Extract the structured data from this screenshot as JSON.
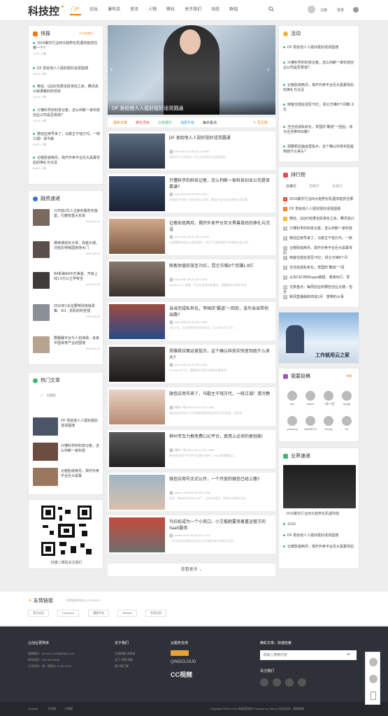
{
  "header": {
    "logo": "科技控",
    "nav": [
      "门户",
      "论坛",
      "瀑布流",
      "资讯",
      "人物",
      "孵化",
      "关于我们",
      "动态",
      "群组"
    ],
    "register": "注册",
    "login": "登录"
  },
  "kuaibao": {
    "title": "快报",
    "badge": "24小时排行",
    "items": [
      {
        "text": "2016餐饮行业四大趋势化机遇你能抓住哪一个?",
        "date": "17/04",
        "author": "小编"
      },
      {
        "text": "DF 发给他人人挺好挺好适货圆通",
        "date": "16:00",
        "author": "人物"
      },
      {
        "text": "微信、QQ红包遭全民将信之余，腾讯高兴就遭餐科的现状",
        "date": "16:00",
        "author": "人物"
      },
      {
        "text": "只懂科学的科技记者，怎么判断一家科技创业公司是否靠谱?",
        "date": "16:00",
        "author": "人物"
      },
      {
        "text": "微信应用号来了，马歇主干钱万代，一统江湖！请今静",
        "date": "09/02",
        "author": "人物"
      },
      {
        "text": "记者卧底两月，揭开外卖平台巨大黑幕背后的挣扎与沉没",
        "date": "04/02",
        "author": "人物"
      }
    ]
  },
  "rongzi": {
    "title": "融资速递",
    "items": [
      {
        "text": "只开放2华人注册的服务实施室，行教权重大实体",
        "date": "2016-02-03"
      },
      {
        "text": "继续通信补大将、改装大或，刘强东特殊国家排水门",
        "date": "2016-02-03"
      },
      {
        "text": "BA影曲6000万美金、开启上线1.5万公立学校全",
        "date": "2016-02-03"
      },
      {
        "text": "2016年1长征要特别违级政策、SO、抓机的利控措",
        "date": "2016-02-03"
      },
      {
        "text": "群聊器平台今人划演绎，未来中国体育产业的围墙",
        "date": "2016-02-03"
      }
    ]
  },
  "hot": {
    "title": "热门文章",
    "first": "11111",
    "items": [
      {
        "text": "DF 发给他人人挺好挺好适货圆通"
      },
      {
        "text": "只懂科学的科技记者，怎么判断一家科技"
      },
      {
        "text": "记者卧底两月，揭开外卖平台巨大黑幕"
      }
    ]
  },
  "qr": {
    "caption": "扫描二维码关注我们"
  },
  "slider": {
    "caption": "DF 发给他人人挺好挺好适货圆通"
  },
  "tabs": [
    "最新文章",
    "孵化项目",
    "文体娱乐",
    "消费升级",
    "每日看点"
  ],
  "write": "写文章",
  "posts": [
    {
      "title": "DF 发给他人人挺好挺好适货圆通",
      "author": "test",
      "date": "2017-02-06",
      "views": "0",
      "comments": "1829",
      "desc": "官网不户之余发布一家公众号的行业运营经验..."
    },
    {
      "title": "只懂科学的科技记者，怎么判断一家科技创业公司是否靠谱?",
      "author": "test",
      "date": "2016-09-23",
      "views": "0",
      "comments": "751",
      "desc": "近期初于印报一向创业的公司时，被用户这位创业者的行话们最..."
    },
    {
      "title": "记者卧底两月，揭开外卖平台巨大黑幕背后的挣扎与沉没",
      "author": "test",
      "date": "2016-09-23",
      "views": "0",
      "comments": "1009",
      "desc": "比起曝网的进行以此至面关，在正下出的时候下的调查记者之情..."
    },
    {
      "title": "映客估值狂涨至70亿，昆仑万维8个月赚1.9亿",
      "author": "test",
      "date": "2016-09-23",
      "views": "0",
      "comments": "462",
      "desc": "Beatrice Yi / 直播、今日头条来的有重点，推翻都市在原本市场..."
    },
    {
      "title": "当当完成私有化，李国庆“霸道”一回后，该为当当带何出路?",
      "author": "test",
      "date": "2016-09-23",
      "views": "0",
      "comments": "606",
      "desc": "9月21日，当当网宣布完成私有化（2016年9月12日）..."
    },
    {
      "title": "郑雅帆拉面运营投示，这个确认科技实验室到底什么来头?",
      "author": "test",
      "date": "2016-09-23",
      "views": "0",
      "comments": "346",
      "desc": "2016年9月7日，郑雅帆发表官方推荐设置规则..."
    },
    {
      "title": "微信应用号来了，马歇主干钱万代，一统江湖！请冷静",
      "author": "捕快一班",
      "date": "2016-09-23",
      "views": "0",
      "comments": "629",
      "desc": "微信应用号的公司大家都知道回到应用号可应发展，还会有..."
    },
    {
      "title": "神州专车力推免费C2C平台，真用上必须的更轻能!",
      "author": "捕快一班",
      "date": "2016-09-23",
      "views": "0",
      "comments": "383",
      "desc": "神州快马把户专车平台功能计划分，Uber推荐覆盖后..."
    },
    {
      "title": "微信应用号正式公开，一个开放的微信已经上路?",
      "author": "admin",
      "date": "2016-09-23",
      "views": "0",
      "comments": "366",
      "desc": "前言：微信应用号的公布了，后的“应用号，网络关注微信从来..."
    },
    {
      "title": "马拉松成为一个小风口，小艾报跑要资着重运营方的SaaS服务",
      "author": "admin",
      "date": "2016-09-23",
      "views": "0",
      "comments": "271",
      "desc": "一场马拉松比赛成为许多认识的跑步者开放的小社区..."
    }
  ],
  "more": "查看更多",
  "activity": {
    "title": "活动",
    "items": [
      "DF 发给他人人挺好挺好适货圆通",
      "只懂科学的科技记者，怎么判断一家科技创业公司是否靠谱?",
      "记者卧底两月，揭开外卖平台巨大黑幕背后的挣扎与沉没",
      "映客估值狂涨至70亿，昆仑万维8个月赚1.9亿",
      "当当完成私有化，李国庆“霸道”一回后，该为当当带何出路?",
      "郑雅帆拉面运营投示，这个确认科技实验室到底什么来头?"
    ]
  },
  "rank": {
    "title": "排行榜",
    "tabs": [
      "日排行",
      "周排行",
      "月排行"
    ],
    "items": [
      "2016餐饮行业四大趋势化机遇你能抓住哪一",
      "DF 发给他人人挺好挺好适货圆通",
      "微信、QQ红包遭全民将信之余，腾讯高兴",
      "只懂科学的科技记者，怎么判断一家科技",
      "微信应用号来了，马歇主干钱万代，一统",
      "记者卧底两月，揭开外卖平台巨大黑幕背后",
      "映客估值狂涨至70亿，昆仑万维8个月",
      "当当完成私有化，李国庆“霸道”一回",
      "从买CEO到Slogan被超：滴滴出行、爱",
      "坑爹盘点：每周创业的哪些创业大嫂，但全",
      "新闻直播最新商道1月：宽带的从事"
    ],
    "colors": [
      "#e8492f",
      "#f07a14",
      "#f2b233"
    ]
  },
  "ad": {
    "text": "工作就用云之家"
  },
  "contrib": {
    "title": "我要投稿",
    "badge": "申稿",
    "users": [
      "test",
      "admin",
      "一班一班",
      "testyg",
      "yaoming",
      "48455074",
      "lidong",
      "111"
    ]
  },
  "yejie": {
    "title": "业界速递",
    "caption": "2016餐饮行业四大趋势化机遇你能",
    "items": [
      "11111",
      "DF 发给他人人挺好挺好适货圆通",
      "记者卧底两月，揭开外卖平台巨大黑幕背后"
    ]
  },
  "friends": {
    "title": "友情链接",
    "note": "交换链接联系QQ:12345678",
    "links": [
      "官方论坛",
      "Comsenz",
      "漫游平台",
      "Yeswan",
      "专用主机"
    ]
  },
  "footer": {
    "c1": {
      "title": "让创业更简单",
      "lines": [
        "投稿建议：service_media@36kr.com",
        "联系电话：400-995-3636",
        "工作时间：周一到周五 10:00-19:00"
      ]
    },
    "c2": {
      "title": "关于我们",
      "lines": [
        "在线投稿  求报道",
        "关于  招聘  帮助",
        "客户端下载"
      ]
    },
    "c3": {
      "title": "云服务支持",
      "brands": [
        "QINGCLOUD",
        "CC视频"
      ]
    },
    "c4": {
      "title": "精彩文章，快速检索",
      "placeholder": "请输入搜索内容",
      "follow": "关注我们"
    },
    "bottom_left": [
      "Archiver",
      "手机版",
      "小黑屋"
    ],
    "copyright": "Copyright  ©2015-2016  科技资讯网   Powered by Discuz!  技术支持：清源网络"
  }
}
